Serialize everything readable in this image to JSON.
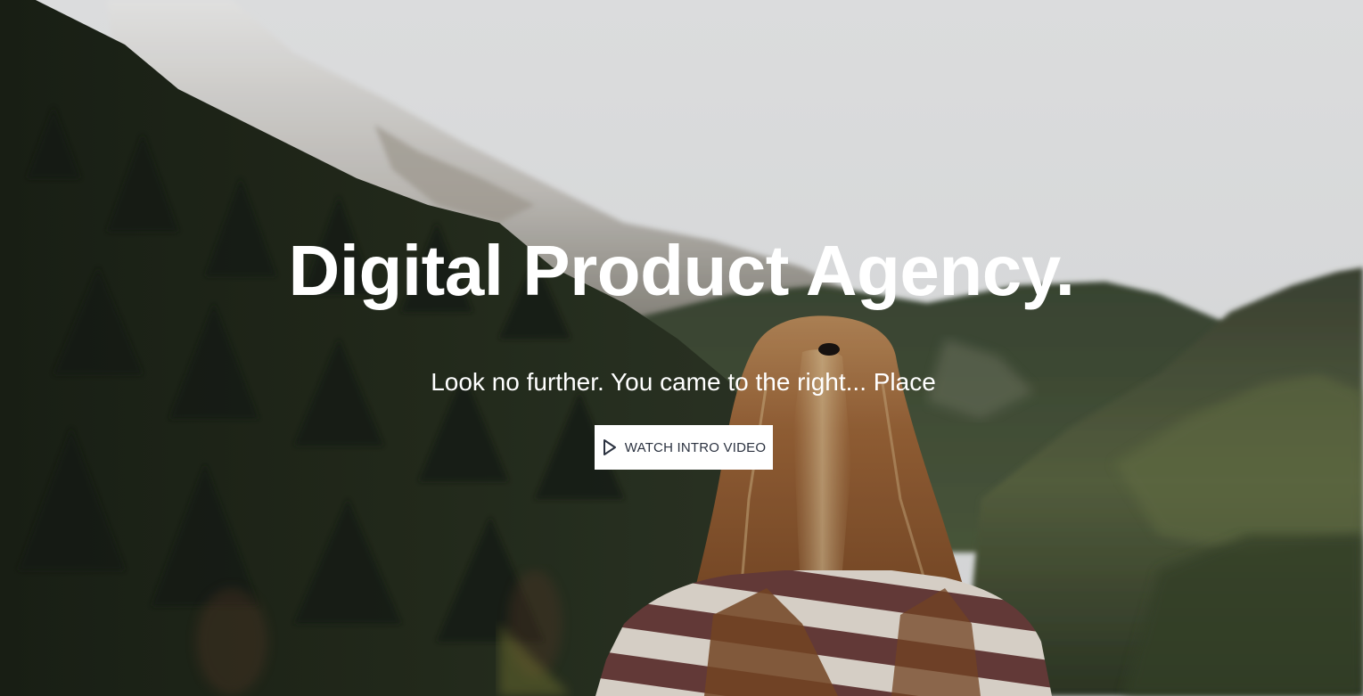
{
  "hero": {
    "headline": "Digital Product Agency.",
    "subline": "Look no further. You came to the right... Place",
    "cta_label": "WATCH INTRO VIDEO",
    "cta_icon": "play-icon"
  },
  "colors": {
    "headline": "#ffffff",
    "cta_background": "#ffffff",
    "cta_text": "#2b3240"
  }
}
